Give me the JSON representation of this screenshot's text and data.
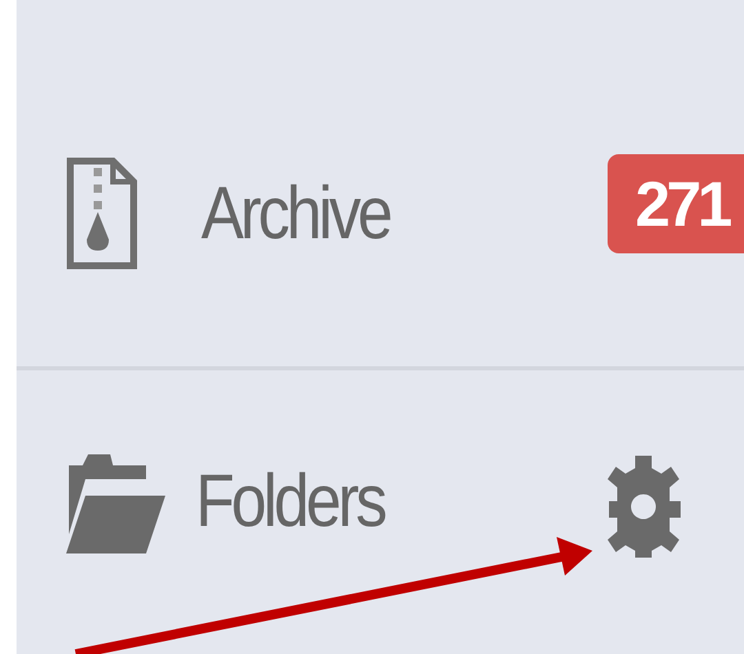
{
  "sidebar": {
    "items": [
      {
        "kind": "archive",
        "label": "Archive",
        "badge": "271"
      },
      {
        "kind": "folders",
        "label": "Folders"
      }
    ]
  },
  "annotations": [
    {
      "kind": "arrow"
    }
  ]
}
